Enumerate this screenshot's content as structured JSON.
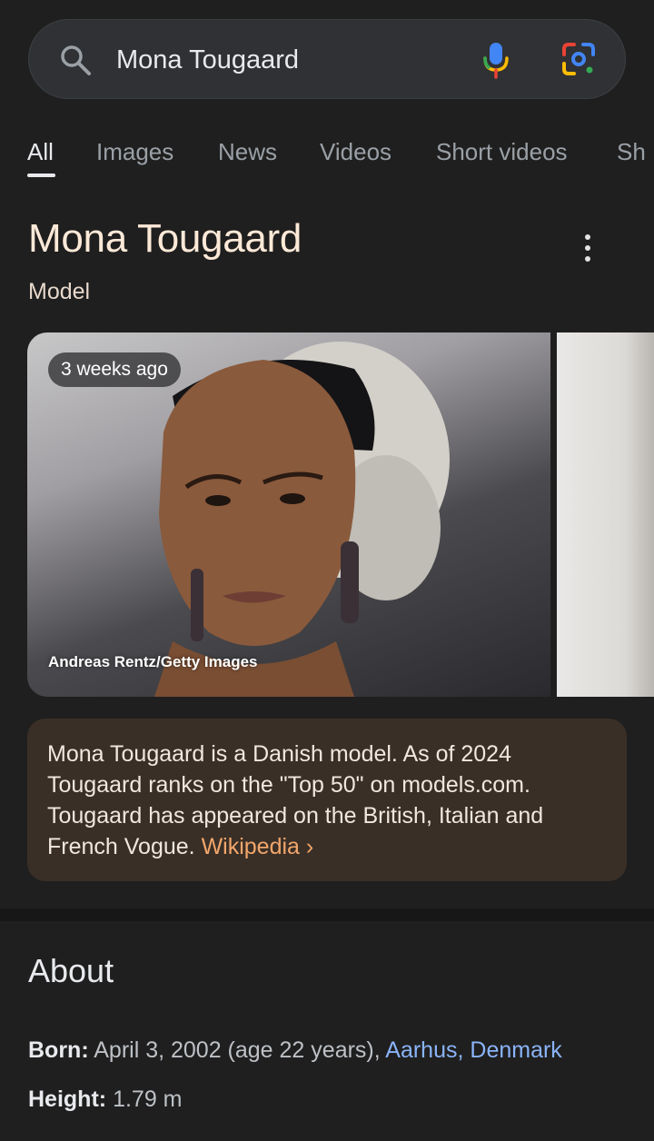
{
  "search": {
    "query": "Mona Tougaard"
  },
  "tabs": [
    "All",
    "Images",
    "News",
    "Videos",
    "Short videos",
    "Sh"
  ],
  "entity": {
    "title": "Mona Tougaard",
    "subtitle": "Model"
  },
  "images": {
    "badge": "3 weeks ago",
    "credit": "Andreas Rentz/Getty Images"
  },
  "description": {
    "text": "Mona Tougaard is a Danish model. As of 2024 Tougaard ranks on the \"Top 50\" on models.com. Tougaard has appeared on the British, Italian and French Vogue.",
    "link": "Wikipedia",
    "chevron": "›"
  },
  "about": {
    "title": "About",
    "born_label": "Born:",
    "born_value": "April 3, 2002 (age 22 years),",
    "born_link": "Aarhus, Denmark",
    "height_label": "Height:",
    "height_value": "1.79 m"
  },
  "colors": {
    "accent_link": "#8ab4f8",
    "wiki_link": "#f2a66b",
    "title": "#fde9d7"
  }
}
